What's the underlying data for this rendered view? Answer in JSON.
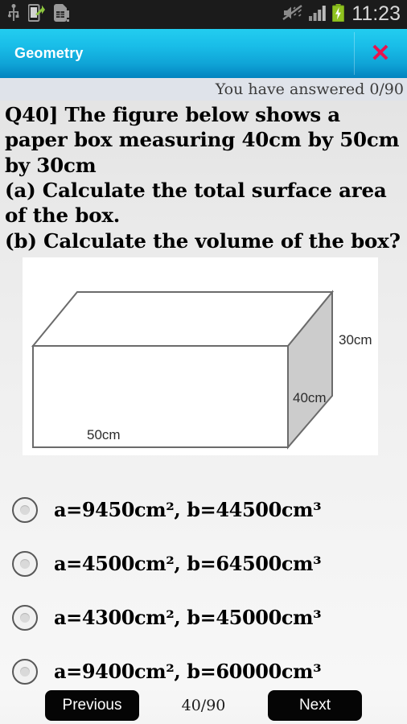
{
  "statusbar": {
    "time": "11:23",
    "icons": [
      "usb-icon",
      "phone-transfer-icon",
      "sim-card-alert-icon",
      "mute-vibrate-off-icon",
      "signal-bars-icon",
      "battery-charging-icon"
    ]
  },
  "titlebar": {
    "title": "Geometry",
    "close_label": "✕"
  },
  "status": {
    "answered_text": "You have answered 0/90"
  },
  "question": {
    "text": "Q40]   The figure below shows a paper box measuring 40cm by 50cm by 30cm\n(a) Calculate the total surface area of the box.\n(b) Calculate the volume of the box?"
  },
  "figure": {
    "name": "paper-box-diagram",
    "labels": {
      "height": "30cm",
      "depth": "40cm",
      "width": "50cm"
    },
    "colors": {
      "stroke": "#6b6b6b",
      "side_fill": "#cccccc",
      "face_fill": "#ffffff",
      "background": "#ffffff"
    }
  },
  "options": [
    {
      "id": "option-a",
      "label": "a=9450cm², b=44500cm³",
      "selected": false
    },
    {
      "id": "option-b",
      "label": "a=4500cm², b=64500cm³",
      "selected": false
    },
    {
      "id": "option-c",
      "label": "a=4300cm², b=45000cm³",
      "selected": false
    },
    {
      "id": "option-d",
      "label": "a=9400cm², b=60000cm³",
      "selected": false
    }
  ],
  "bottombar": {
    "previous_label": "Previous",
    "counter": "40/90",
    "next_label": "Next"
  },
  "theme": {
    "header_top": "#23cdf0",
    "header_bottom": "#0283bf",
    "close_color": "#e8134e",
    "strip_bg": "#dfe3ea",
    "button_bg": "#050505"
  }
}
